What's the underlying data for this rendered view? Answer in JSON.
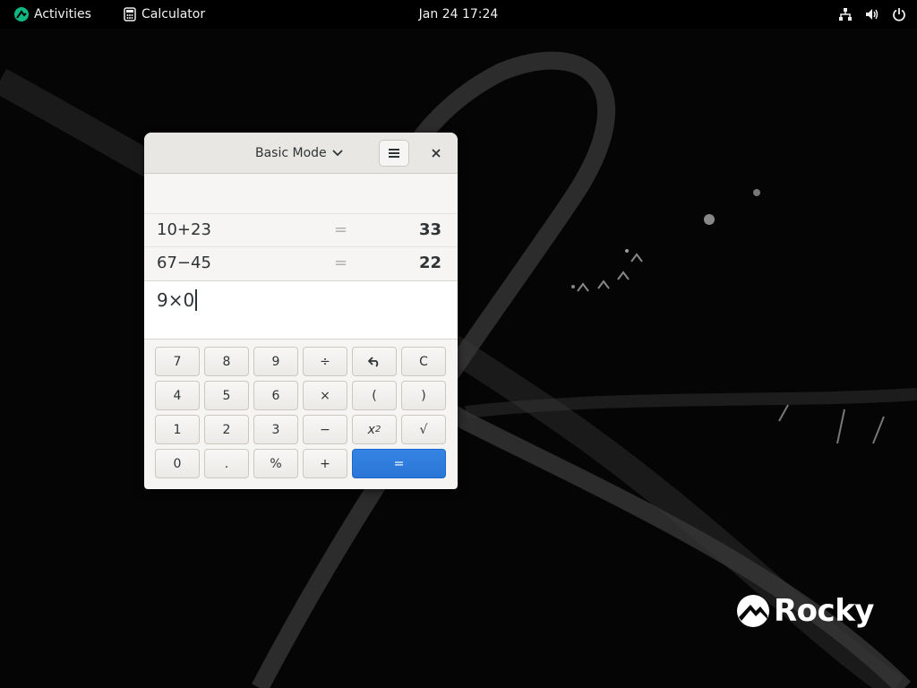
{
  "topbar": {
    "activities_label": "Activities",
    "app_label": "Calculator",
    "datetime": "Jan 24  17:24",
    "icons": [
      "network-icon",
      "volume-icon",
      "power-icon"
    ]
  },
  "calculator": {
    "mode_label": "Basic Mode",
    "history": [
      {
        "expression": "10+23",
        "equals": "=",
        "result": "33"
      },
      {
        "expression": "67−45",
        "equals": "=",
        "result": "22"
      }
    ],
    "input_value": "9×0",
    "keys": {
      "k7": "7",
      "k8": "8",
      "k9": "9",
      "divide": "÷",
      "clear": "C",
      "k4": "4",
      "k5": "5",
      "k6": "6",
      "multiply": "×",
      "open_paren": "(",
      "close_paren": ")",
      "k1": "1",
      "k2": "2",
      "k3": "3",
      "subtract": "−",
      "square_base": "x",
      "square_exp": "2",
      "sqrt": "√",
      "k0": "0",
      "point": ".",
      "percent": "%",
      "add": "+",
      "equals": "="
    }
  },
  "colors": {
    "accent": "#3584e4",
    "window_bg": "#f6f5f4",
    "topbar_bg": "#000000"
  },
  "logo": {
    "text": "Rocky"
  }
}
